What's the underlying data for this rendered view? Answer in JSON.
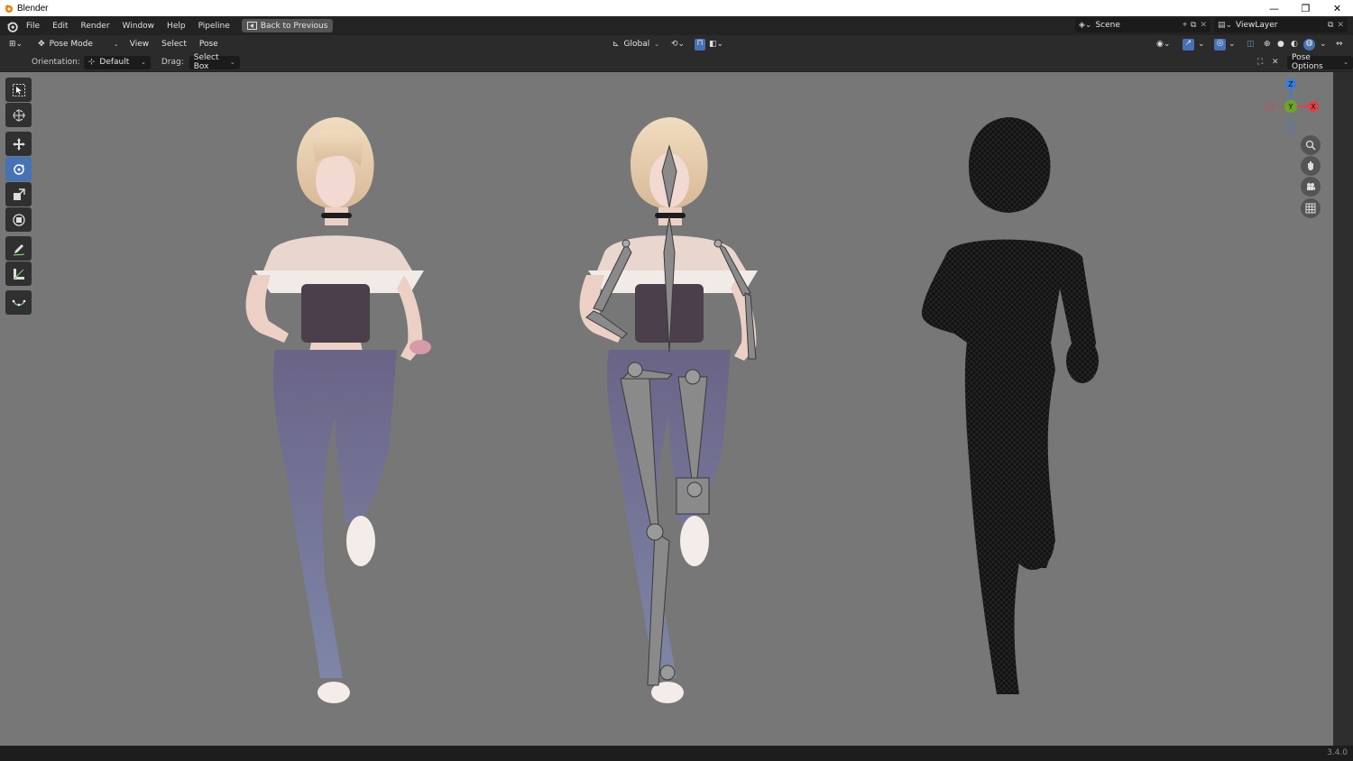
{
  "window": {
    "title": "Blender",
    "minimize": "—",
    "maximize": "❐",
    "close": "✕"
  },
  "menu": {
    "items": [
      "File",
      "Edit",
      "Render",
      "Window",
      "Help",
      "Pipeline"
    ],
    "back_button": "Back to Previous"
  },
  "scene": {
    "label": "Scene",
    "viewlayer": "ViewLayer"
  },
  "header": {
    "mode": "Pose Mode",
    "menus": [
      "View",
      "Select",
      "Pose"
    ],
    "transform_orientation": "Global"
  },
  "tool_settings": {
    "orientation_label": "Orientation:",
    "orientation_value": "Default",
    "drag_label": "Drag:",
    "drag_value": "Select Box",
    "pose_options": "Pose Options"
  },
  "gizmo": {
    "z": "Z",
    "y": "Y",
    "x": "X"
  },
  "status": {
    "version": "3.4.0"
  },
  "colors": {
    "viewport_bg": "#777777",
    "active_tool": "#4772b3",
    "axis_x": "#e0404a",
    "axis_y": "#6ea42a",
    "axis_z": "#3b7be0"
  }
}
